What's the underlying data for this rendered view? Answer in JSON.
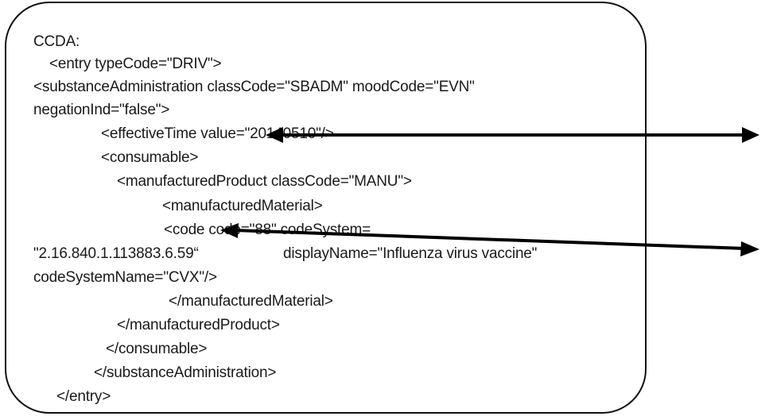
{
  "lines": [
    "CCDA:",
    "<entry typeCode=\"DRIV\">",
    "<substanceAdministration classCode=\"SBADM\" moodCode=\"EVN\"",
    "negationInd=\"false\">",
    "<effectiveTime value=\"20140510\"/>",
    "<consumable>",
    "<manufacturedProduct classCode=\"MANU\">",
    "<manufacturedMaterial>",
    "<code code=\"88\" codeSystem=",
    "\"2.16.840.1.113883.6.59“",
    "displayName=\"Influenza virus vaccine\"",
    "codeSystemName=\"CVX\"/>",
    "</manufacturedMaterial>",
    "</manufacturedProduct>",
    "</consumable>",
    "</substanceAdministration>",
    "</entry>"
  ],
  "colors": {
    "text": "#1a1a1a",
    "border": "#111111",
    "arrow": "#000000"
  }
}
